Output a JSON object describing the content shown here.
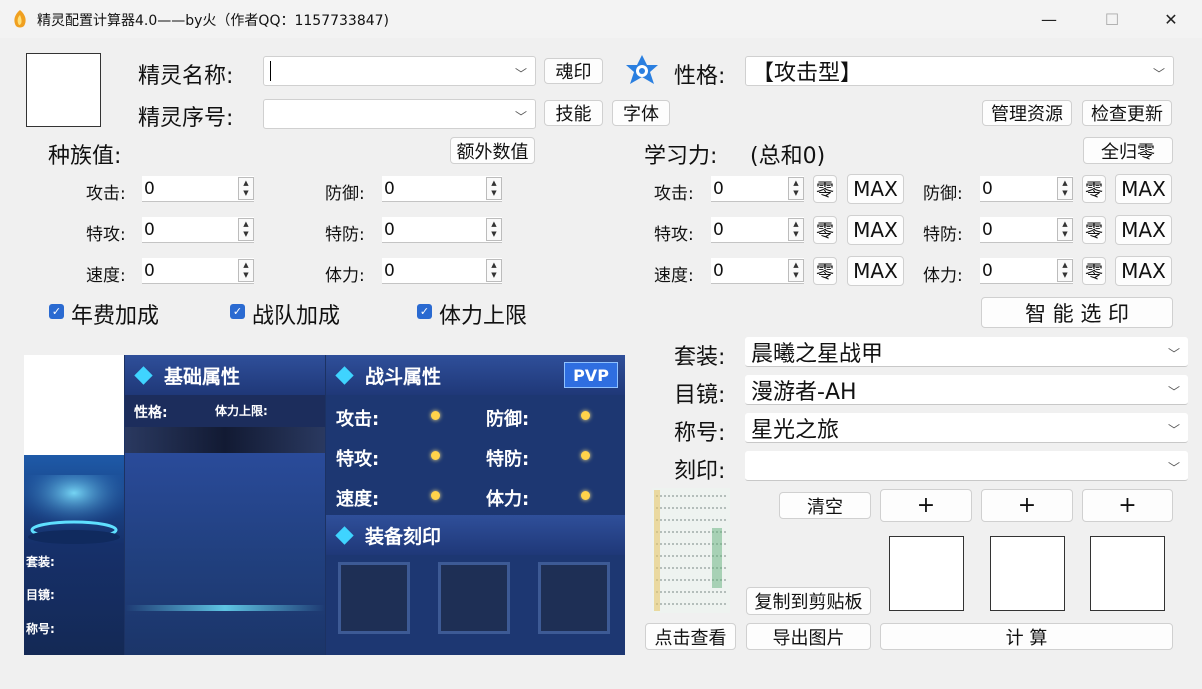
{
  "window": {
    "title": "精灵配置计算器4.0——by火（作者QQ：1157733847)",
    "minimize_glyph": "—",
    "maximize_glyph": "☐",
    "close_glyph": "✕"
  },
  "top": {
    "name_label": "精灵名称:",
    "name_value": "",
    "index_label": "精灵序号:",
    "index_value": "",
    "soul_button": "魂印",
    "skill_button": "技能",
    "font_button": "字体",
    "nature_label": "性格:",
    "nature_value": "【攻击型】",
    "manage_button": "管理资源",
    "update_button": "检查更新"
  },
  "base": {
    "title": "种族值:",
    "extra_button": "额外数值",
    "stats": [
      {
        "label": "攻击:",
        "value": "0"
      },
      {
        "label": "防御:",
        "value": "0"
      },
      {
        "label": "特攻:",
        "value": "0"
      },
      {
        "label": "特防:",
        "value": "0"
      },
      {
        "label": "速度:",
        "value": "0"
      },
      {
        "label": "体力:",
        "value": "0"
      }
    ]
  },
  "checks": [
    {
      "label": "年费加成",
      "checked": true
    },
    {
      "label": "战队加成",
      "checked": true
    },
    {
      "label": "体力上限",
      "checked": true
    }
  ],
  "learn": {
    "title": "学习力:",
    "total": "(总和0)",
    "reset_all_button": "全归零",
    "zero_label": "零",
    "max_label": "MAX",
    "stats": [
      {
        "label": "攻击:",
        "value": "0"
      },
      {
        "label": "防御:",
        "value": "0"
      },
      {
        "label": "特攻:",
        "value": "0"
      },
      {
        "label": "特防:",
        "value": "0"
      },
      {
        "label": "速度:",
        "value": "0"
      },
      {
        "label": "体力:",
        "value": "0"
      }
    ],
    "smart_button": "智 能 选 印"
  },
  "equip": [
    {
      "label": "套装:",
      "value": "晨曦之星战甲"
    },
    {
      "label": "目镜:",
      "value": "漫游者-AH"
    },
    {
      "label": "称号:",
      "value": "星光之旅"
    },
    {
      "label": "刻印:",
      "value": ""
    }
  ],
  "actions": {
    "clear": "清空",
    "plus": "+",
    "copy": "复制到剪贴板",
    "view": "点击查看",
    "export": "导出图片",
    "calc": "计 算"
  },
  "card": {
    "basic_title": "基础属性",
    "nature_label": "性格:",
    "hp_limit_label": "体力上限:",
    "battle_title": "战斗属性",
    "pvp_badge": "PVP",
    "battle_stats": [
      "攻击:",
      "防御:",
      "特攻:",
      "特防:",
      "速度:",
      "体力:"
    ],
    "equip_title": "装备刻印",
    "side_labels": [
      "套装:",
      "目镜:",
      "称号:"
    ]
  },
  "colors": {
    "card_bg": "#1c3263",
    "accent_cyan": "#3fd4ff",
    "check_blue": "#2a6ad1"
  }
}
